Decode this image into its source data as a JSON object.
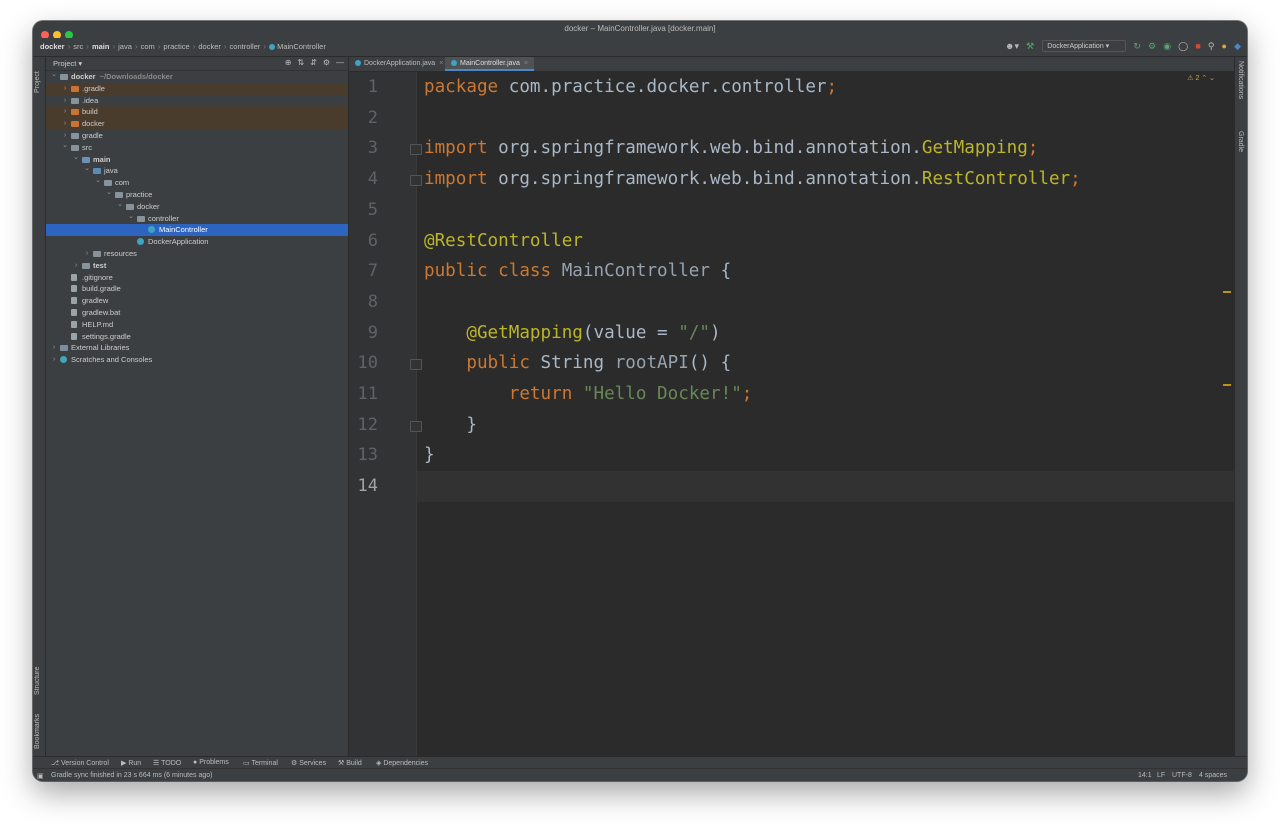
{
  "window": {
    "title": "docker – MainController.java [docker.main]"
  },
  "breadcrumbs": [
    "docker",
    "src",
    "main",
    "java",
    "com",
    "practice",
    "docker",
    "controller",
    "MainController"
  ],
  "toolbar": {
    "run_config": "DockerApplication"
  },
  "project_panel": {
    "title": "Project",
    "tree": [
      {
        "label": "docker",
        "hint": "~/Downloads/docker",
        "depth": 0,
        "icon": "folder-icon",
        "arrow": "down",
        "bold": true
      },
      {
        "label": ".gradle",
        "depth": 1,
        "icon": "folder-orange-icon",
        "arrow": "right",
        "highlight": true
      },
      {
        "label": ".idea",
        "depth": 1,
        "icon": "folder-icon",
        "arrow": "right"
      },
      {
        "label": "build",
        "depth": 1,
        "icon": "folder-orange-icon",
        "arrow": "right",
        "highlight": true
      },
      {
        "label": "docker",
        "depth": 1,
        "icon": "folder-orange-icon",
        "arrow": "right",
        "highlight": true
      },
      {
        "label": "gradle",
        "depth": 1,
        "icon": "folder-icon",
        "arrow": "right"
      },
      {
        "label": "src",
        "depth": 1,
        "icon": "folder-icon",
        "arrow": "down"
      },
      {
        "label": "main",
        "depth": 2,
        "icon": "source-folder-icon",
        "arrow": "down",
        "bold": true
      },
      {
        "label": "java",
        "depth": 3,
        "icon": "java-folder-icon",
        "arrow": "down"
      },
      {
        "label": "com",
        "depth": 4,
        "icon": "package-icon",
        "arrow": "down"
      },
      {
        "label": "practice",
        "depth": 5,
        "icon": "package-icon",
        "arrow": "down"
      },
      {
        "label": "docker",
        "depth": 6,
        "icon": "package-icon",
        "arrow": "down"
      },
      {
        "label": "controller",
        "depth": 7,
        "icon": "package-icon",
        "arrow": "down"
      },
      {
        "label": "MainController",
        "depth": 8,
        "icon": "class-icon",
        "arrow": "",
        "selected": true
      },
      {
        "label": "DockerApplication",
        "depth": 7,
        "icon": "class-icon",
        "arrow": ""
      },
      {
        "label": "resources",
        "depth": 3,
        "icon": "resources-folder-icon",
        "arrow": "right"
      },
      {
        "label": "test",
        "depth": 2,
        "icon": "test-folder-icon",
        "arrow": "right",
        "bold": true
      },
      {
        "label": ".gitignore",
        "depth": 1,
        "icon": "file-icon",
        "arrow": ""
      },
      {
        "label": "build.gradle",
        "depth": 1,
        "icon": "gradle-file-icon",
        "arrow": ""
      },
      {
        "label": "gradlew",
        "depth": 1,
        "icon": "file-icon",
        "arrow": ""
      },
      {
        "label": "gradlew.bat",
        "depth": 1,
        "icon": "file-icon",
        "arrow": ""
      },
      {
        "label": "HELP.md",
        "depth": 1,
        "icon": "markdown-file-icon",
        "arrow": ""
      },
      {
        "label": "settings.gradle",
        "depth": 1,
        "icon": "gradle-file-icon",
        "arrow": ""
      },
      {
        "label": "External Libraries",
        "depth": 0,
        "icon": "library-icon",
        "arrow": "right"
      },
      {
        "label": "Scratches and Consoles",
        "depth": 0,
        "icon": "scratches-icon",
        "arrow": "right"
      }
    ]
  },
  "tabs": [
    {
      "label": "DockerApplication.java",
      "active": false
    },
    {
      "label": "MainController.java",
      "active": true
    }
  ],
  "editor": {
    "warning_count": "2",
    "current_line": 14,
    "lines": [
      [
        {
          "t": "package",
          "c": "kw"
        },
        {
          "t": " com.practice.docker.controller",
          "c": ""
        },
        {
          "t": ";",
          "c": "kw"
        }
      ],
      [],
      [
        {
          "t": "import",
          "c": "kw"
        },
        {
          "t": " org.springframework.web.bind.annotation.",
          "c": ""
        },
        {
          "t": "GetMapping",
          "c": "ann"
        },
        {
          "t": ";",
          "c": "kw"
        }
      ],
      [
        {
          "t": "import",
          "c": "kw"
        },
        {
          "t": " org.springframework.web.bind.annotation.",
          "c": ""
        },
        {
          "t": "RestController",
          "c": "ann"
        },
        {
          "t": ";",
          "c": "kw"
        }
      ],
      [],
      [
        {
          "t": "@RestController",
          "c": "ann"
        }
      ],
      [
        {
          "t": "public class",
          "c": "kw"
        },
        {
          "t": " ",
          "c": ""
        },
        {
          "t": "MainController",
          "c": "cls2"
        },
        {
          "t": " {",
          "c": ""
        }
      ],
      [],
      [
        {
          "t": "    ",
          "c": ""
        },
        {
          "t": "@GetMapping",
          "c": "ann"
        },
        {
          "t": "(value = ",
          "c": ""
        },
        {
          "t": "\"/\"",
          "c": "str"
        },
        {
          "t": ")",
          "c": ""
        }
      ],
      [
        {
          "t": "    ",
          "c": ""
        },
        {
          "t": "public",
          "c": "kw"
        },
        {
          "t": " String ",
          "c": ""
        },
        {
          "t": "rootAPI",
          "c": "cls2"
        },
        {
          "t": "() {",
          "c": ""
        }
      ],
      [
        {
          "t": "        ",
          "c": ""
        },
        {
          "t": "return",
          "c": "kw"
        },
        {
          "t": " ",
          "c": ""
        },
        {
          "t": "\"Hello Docker!\"",
          "c": "str"
        },
        {
          "t": ";",
          "c": "kw"
        }
      ],
      [
        {
          "t": "    }",
          "c": ""
        }
      ],
      [
        {
          "t": "}",
          "c": ""
        }
      ],
      []
    ]
  },
  "left_strip": [
    "Project",
    "Structure",
    "Bookmarks"
  ],
  "right_strip": [
    "Notifications",
    "Gradle"
  ],
  "bottom_tools": [
    "Version Control",
    "Run",
    "TODO",
    "Problems",
    "Terminal",
    "Services",
    "Build",
    "Dependencies"
  ],
  "status": {
    "message": "Gradle sync finished in 23 s 664 ms (6 minutes ago)",
    "position": "14:1",
    "line_sep": "LF",
    "encoding": "UTF-8",
    "indent": "4 spaces"
  },
  "colors": {
    "keyword": "#cc7832",
    "annotation": "#bbb529",
    "string": "#6a8759",
    "text": "#a9b7c6",
    "selection": "#2d64c0"
  }
}
